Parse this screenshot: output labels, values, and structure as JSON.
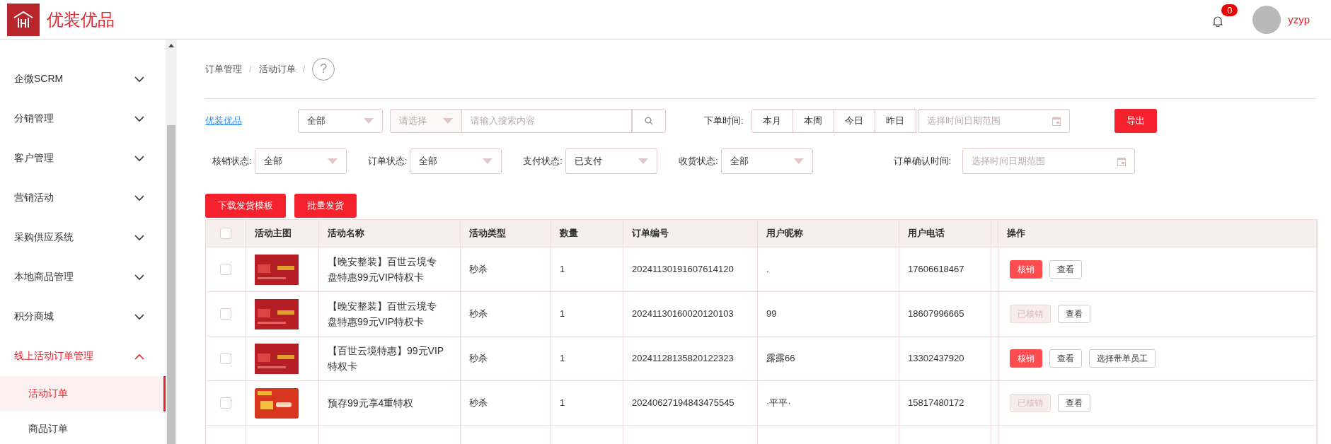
{
  "header": {
    "brand": "优装优品",
    "notification_count": "0",
    "user_name": "yzyp"
  },
  "sidebar": {
    "items": [
      {
        "label": "企微SCRM",
        "expanded": false
      },
      {
        "label": "分销管理",
        "expanded": false
      },
      {
        "label": "客户管理",
        "expanded": false
      },
      {
        "label": "营销活动",
        "expanded": false
      },
      {
        "label": "采购供应系统",
        "expanded": false
      },
      {
        "label": "本地商品管理",
        "expanded": false
      },
      {
        "label": "积分商城",
        "expanded": false
      },
      {
        "label": "线上活动订单管理",
        "expanded": true,
        "children": [
          {
            "label": "活动订单",
            "selected": true
          },
          {
            "label": "商品订单",
            "selected": false
          }
        ]
      }
    ]
  },
  "breadcrumb": {
    "items": [
      "订单管理",
      "活动订单"
    ],
    "separator": "/",
    "help": "?"
  },
  "filters": {
    "shop_link": "优装优品",
    "scope_select": {
      "value": "全部"
    },
    "field_select": {
      "placeholder": "请选择"
    },
    "search": {
      "placeholder": "请输入搜索内容"
    },
    "order_time": {
      "label": "下单时间:",
      "ranges": [
        "本月",
        "本周",
        "今日",
        "昨日"
      ],
      "placeholder": "选择时间日期范围"
    },
    "export_button": "导出",
    "status_filters": [
      {
        "label": "核销状态:",
        "value": "全部"
      },
      {
        "label": "订单状态:",
        "value": "全部"
      },
      {
        "label": "支付状态:",
        "value": "已支付"
      },
      {
        "label": "收货状态:",
        "value": "全部"
      }
    ],
    "confirm_time": {
      "label": "订单确认时间:",
      "placeholder": "选择时间日期范围"
    }
  },
  "toolbar": [
    "下载发货模板",
    "批量发货"
  ],
  "table": {
    "all_selected": false,
    "columns": [
      "活动主图",
      "活动名称",
      "活动类型",
      "数量",
      "订单编号",
      "用户昵称",
      "用户电话",
      "操作"
    ],
    "rows": [
      {
        "selected": false,
        "kind": "vip",
        "name": "【晚安整装】百世云境专盘特惠99元VIP特权卡",
        "type": "秒杀",
        "quantity": "1",
        "order_no": "20241130191607614120",
        "nickname": ".",
        "phone": "17606618467",
        "actions": [
          {
            "kind": "verify",
            "label": "核销",
            "disabled": false
          },
          {
            "kind": "plain",
            "label": "查看"
          }
        ]
      },
      {
        "selected": false,
        "kind": "vip",
        "name": "【晚安整装】百世云境专盘特惠99元VIP特权卡",
        "type": "秒杀",
        "quantity": "1",
        "order_no": "20241130160020120103",
        "nickname": "99",
        "phone": "18607996665",
        "actions": [
          {
            "kind": "verify",
            "label": "已核销",
            "disabled": true
          },
          {
            "kind": "plain",
            "label": "查看"
          }
        ]
      },
      {
        "selected": false,
        "kind": "vip",
        "name": "【百世云境特惠】99元VIP特权卡",
        "type": "秒杀",
        "quantity": "1",
        "order_no": "20241128135820122323",
        "nickname": "露露66",
        "phone": "13302437920",
        "actions": [
          {
            "kind": "verify",
            "label": "核销",
            "disabled": false
          },
          {
            "kind": "plain",
            "label": "查看"
          },
          {
            "kind": "plain",
            "label": "选择带单员工"
          }
        ]
      },
      {
        "selected": false,
        "kind": "deposit",
        "name": "预存99元享4重特权",
        "type": "秒杀",
        "quantity": "1",
        "order_no": "20240627194843475545",
        "nickname": "·平平·",
        "phone": "15817480172",
        "actions": [
          {
            "kind": "verify",
            "label": "已核销",
            "disabled": true
          },
          {
            "kind": "plain",
            "label": "查看"
          }
        ]
      }
    ]
  }
}
